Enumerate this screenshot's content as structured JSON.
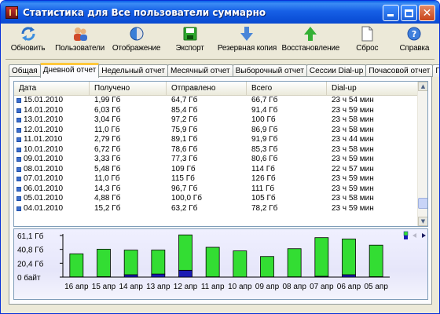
{
  "window": {
    "title": "Статистика для Все пользователи суммарно"
  },
  "toolbar": {
    "items": [
      {
        "label": "Обновить",
        "icon": "refresh-icon"
      },
      {
        "label": "Пользователи",
        "icon": "users-icon"
      },
      {
        "label": "Отображение",
        "icon": "display-icon"
      },
      {
        "label": "Экспорт",
        "icon": "save-icon"
      },
      {
        "label": "Резервная копия",
        "icon": "backup-arrow-icon"
      },
      {
        "label": "Восстановление",
        "icon": "restore-arrow-icon"
      },
      {
        "label": "Сброс",
        "icon": "document-icon"
      },
      {
        "label": "Справка",
        "icon": "help-icon"
      }
    ]
  },
  "tabs": [
    {
      "label": "Общая",
      "active": false
    },
    {
      "label": "Дневной отчет",
      "active": true
    },
    {
      "label": "Недельный отчет",
      "active": false
    },
    {
      "label": "Месячный отчет",
      "active": false
    },
    {
      "label": "Выборочный отчет",
      "active": false
    },
    {
      "label": "Сессии Dial-up",
      "active": false
    },
    {
      "label": "Почасовой отчет",
      "active": false
    },
    {
      "label": "По пользователям",
      "active": false
    }
  ],
  "table": {
    "columns": [
      "Дата",
      "Получено",
      "Отправлено",
      "Всего",
      "Dial-up"
    ],
    "rows": [
      [
        "15.01.2010",
        "1,99 Гб",
        "64,7 Гб",
        "66,7 Гб",
        "23 ч 54 мин"
      ],
      [
        "14.01.2010",
        "6,03 Гб",
        "85,4 Гб",
        "91,4 Гб",
        "23 ч 59 мин"
      ],
      [
        "13.01.2010",
        "3,04 Гб",
        "97,2 Гб",
        "100 Гб",
        "23 ч 58 мин"
      ],
      [
        "12.01.2010",
        "11,0 Гб",
        "75,9 Гб",
        "86,9 Гб",
        "23 ч 58 мин"
      ],
      [
        "11.01.2010",
        "2,79 Гб",
        "89,1 Гб",
        "91,9 Гб",
        "23 ч 44 мин"
      ],
      [
        "10.01.2010",
        "6,72 Гб",
        "78,6 Гб",
        "85,3 Гб",
        "23 ч 58 мин"
      ],
      [
        "09.01.2010",
        "3,33 Гб",
        "77,3 Гб",
        "80,6 Гб",
        "23 ч 59 мин"
      ],
      [
        "08.01.2010",
        "5,48 Гб",
        "109 Гб",
        "114 Гб",
        "22 ч 57 мин"
      ],
      [
        "07.01.2010",
        "11,0 Гб",
        "115 Гб",
        "126 Гб",
        "23 ч 59 мин"
      ],
      [
        "06.01.2010",
        "14,3 Гб",
        "96,7 Гб",
        "111 Гб",
        "23 ч 59 мин"
      ],
      [
        "05.01.2010",
        "4,88 Гб",
        "100,0 Гб",
        "105 Гб",
        "23 ч 58 мин"
      ],
      [
        "04.01.2010",
        "15,2 Гб",
        "63,2 Гб",
        "78,2 Гб",
        "23 ч 59 мин"
      ]
    ]
  },
  "chart_data": {
    "type": "bar",
    "stacked": true,
    "categories": [
      "16 апр",
      "15 апр",
      "14 апр",
      "13 апр",
      "12 апр",
      "11 апр",
      "10 апр",
      "09 апр",
      "08 апр",
      "07 апр",
      "06 апр",
      "05 апр"
    ],
    "series": [
      {
        "color": "#1a1ab4",
        "values": [
          0.3,
          0.6,
          3.5,
          4.5,
          10.0,
          0.4,
          0.2,
          0.3,
          0.4,
          1.2,
          3.5,
          0.6
        ]
      },
      {
        "color": "#33dd33",
        "values": [
          33.9,
          40.4,
          36.2,
          35.3,
          52.0,
          43.4,
          38.3,
          30.0,
          41.4,
          56.8,
          52.5,
          46.4
        ]
      }
    ],
    "y_ticks": [
      "61,1 Гб",
      "40,8 Гб",
      "20,4 Гб",
      "0 байт"
    ],
    "ylim": [
      0,
      61.1
    ],
    "grid": false,
    "legend": "none"
  }
}
